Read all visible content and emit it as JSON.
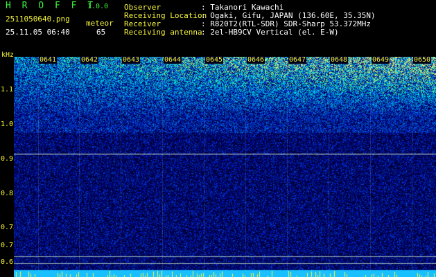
{
  "app": {
    "brand": "H R O F F T",
    "version": "1.0.0",
    "filename": "2511050640.png",
    "datetime": "25.11.05 06:40",
    "meteor_label": "meteor",
    "meteor_count": "65"
  },
  "info": [
    {
      "label": "Observer",
      "value": ": Takanori Kawachi"
    },
    {
      "label": "Receiving Location",
      "value": ": Ogaki, Gifu, JAPAN (136.60E, 35.35N)"
    },
    {
      "label": "Receiver",
      "value": ": R820T2(RTL-SDR) SDR-Sharp 53.372MHz"
    },
    {
      "label": "Receiving antenna",
      "value": ": 2el-HB9CV Vertical (el. E-W)"
    }
  ],
  "y_axis": {
    "unit": "kHz",
    "ticks": [
      "1.1",
      "1.0",
      "0.9",
      "0.8",
      "0.75",
      "0.7",
      "0.6"
    ]
  },
  "x_axis": {
    "ticks": [
      "0641",
      "0642",
      "0643",
      "0644",
      "0645",
      "0646",
      "0647",
      "0648",
      "0649",
      "0650"
    ]
  },
  "colors": {
    "label_yellow": "#f5f53c",
    "brand_green": "#3cf53c",
    "signal_line": "#d8f0c8",
    "bottom_bar": "#18c0ff"
  }
}
